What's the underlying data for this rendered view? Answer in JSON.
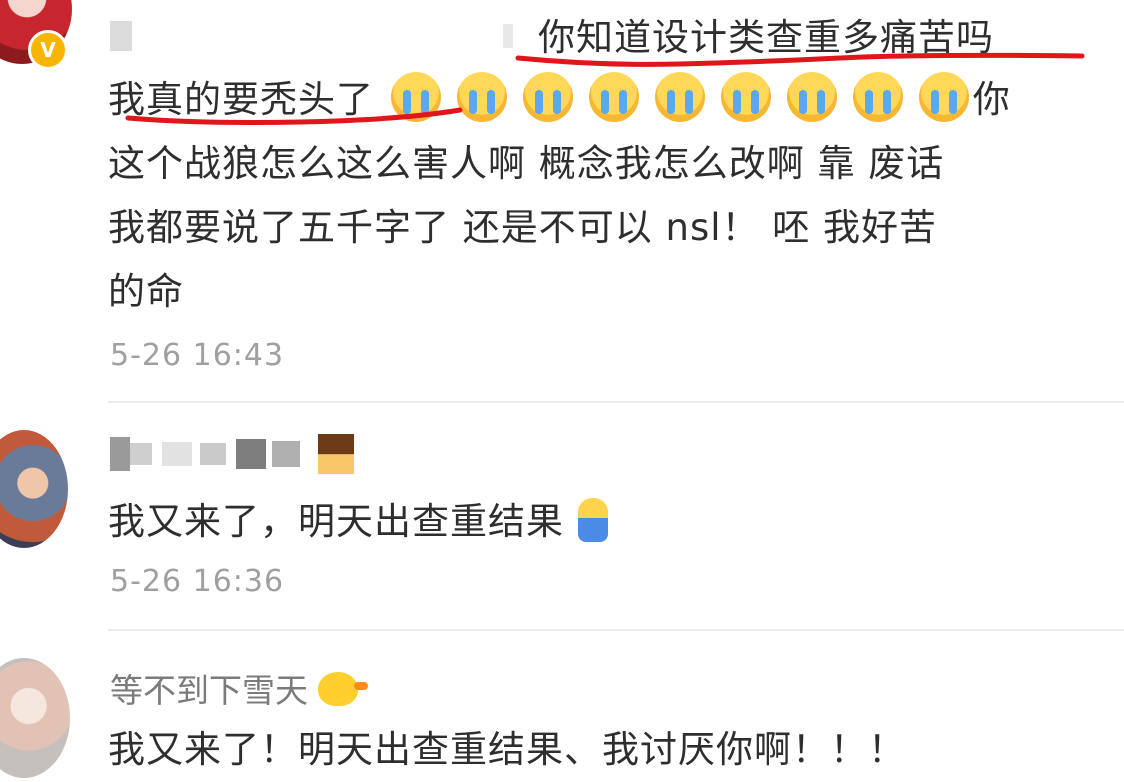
{
  "comments": [
    {
      "username": "",
      "verified_badge": "V",
      "quote": "你知道设计类查重多痛苦吗",
      "text_line1": "我真的要秃头了",
      "text_line1_tail": "你",
      "text_line2": "这个战狼怎么这么害人啊 概念我怎么改啊 靠 废话",
      "text_line3": "我都要说了五千字了 还是不可以 nsl！ 呸 我好苦",
      "text_line4": "的命",
      "time": "5-26 16:43"
    },
    {
      "username": "",
      "text": "我又来了，明天出查重结果",
      "time": "5-26 16:36"
    },
    {
      "username": "等不到下雪天",
      "text": "我又来了！明天出查重结果、我讨厌你啊！！！"
    }
  ],
  "icons": {
    "crying_emoji": "crying-face-icon",
    "duck_emoji": "duck-icon",
    "pray_emoji": "praying-icon"
  },
  "colors": {
    "annotation": "#e0161b",
    "time": "#a0a0a0"
  }
}
